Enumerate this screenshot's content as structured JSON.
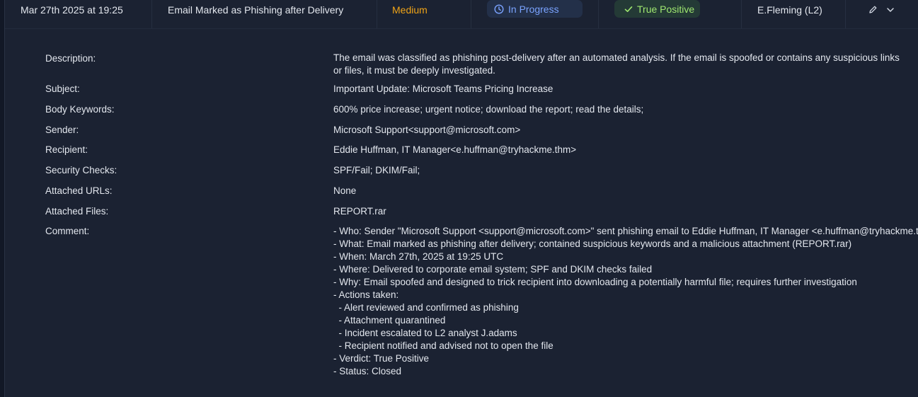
{
  "alert": {
    "date": "Mar 27th 2025 at 19:25",
    "title": "Email Marked as Phishing after Delivery",
    "severity": "Medium",
    "severity_color": "#f0a417",
    "status": "In Progress",
    "status_icon": "clock-icon",
    "verdict": "True Positive",
    "verdict_icon": "check-icon",
    "assignee": "E.Fleming (L2)",
    "actions": [
      "pencil-icon",
      "chevron-down-icon"
    ]
  },
  "details": {
    "description_label": "Description:",
    "description": "The email was classified as phishing post-delivery after an automated analysis. If the email is spoofed or contains any suspicious links or files, it must be deeply investigated.",
    "subject_label": "Subject:",
    "subject": "Important Update: Microsoft Teams Pricing Increase",
    "body_keywords_label": "Body Keywords:",
    "body_keywords": "600% price increase; urgent notice; download the report; read the details;",
    "sender_label": "Sender:",
    "sender": "Microsoft Support<support@microsoft.com>",
    "recipient_label": "Recipient:",
    "recipient": "Eddie Huffman, IT Manager<e.huffman@tryhackme.thm>",
    "security_checks_label": "Security Checks:",
    "security_checks": "SPF/Fail; DKIM/Fail;",
    "attached_urls_label": "Attached URLs:",
    "attached_urls": "None",
    "attached_files_label": "Attached Files:",
    "attached_files": "REPORT.rar",
    "comment_label": "Comment:",
    "comment_lines": [
      "- Who: Sender \"Microsoft Support <support@microsoft.com>\" sent phishing email to Eddie Huffman, IT Manager <e.huffman@tryhackme.thm>",
      "- What: Email marked as phishing after delivery; contained suspicious keywords and a malicious attachment (REPORT.rar)",
      "- When: March 27th, 2025 at 19:25 UTC",
      "- Where: Delivered to corporate email system; SPF and DKIM checks failed",
      "- Why: Email spoofed and designed to trick recipient into downloading a potentially harmful file; requires further investigation",
      "- Actions taken:",
      "  - Alert reviewed and confirmed as phishing",
      "  - Attachment quarantined",
      "  - Incident escalated to L2 analyst J.adams",
      "  - Recipient notified and advised not to open the file",
      "- Verdict: True Positive",
      "- Status: Closed"
    ]
  }
}
